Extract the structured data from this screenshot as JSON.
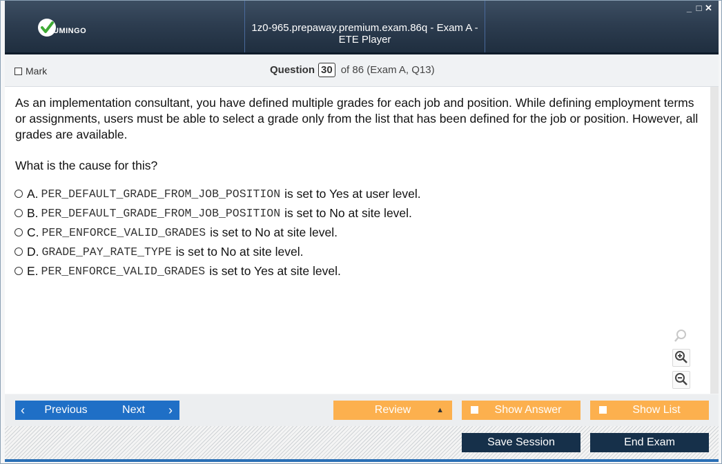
{
  "window": {
    "logo_text": "UMINGO",
    "title": "1z0-965.prepaway.premium.exam.86q - Exam A - ETE Player",
    "controls": [
      "_",
      "□",
      "✕"
    ]
  },
  "question_header": {
    "mark_label": "Mark",
    "question_label": "Question",
    "question_number": "30",
    "of_text": "of 86 (Exam A, Q13)"
  },
  "question": {
    "stem": "As an implementation consultant, you have defined multiple grades for each job and position. While defining employment terms or assignments, users must be able to select a grade only from the list that has been defined for the job or position. However, all grades are available.",
    "prompt": "What is the cause for this?",
    "options": [
      {
        "letter": "A.",
        "code": "PER_DEFAULT_GRADE_FROM_JOB_POSITION",
        "text": "is set to Yes at user level."
      },
      {
        "letter": "B.",
        "code": "PER_DEFAULT_GRADE_FROM_JOB_POSITION",
        "text": "is set to No at site level."
      },
      {
        "letter": "C.",
        "code": "PER_ENFORCE_VALID_GRADES",
        "text": "is set to No at site level."
      },
      {
        "letter": "D.",
        "code": "GRADE_PAY_RATE_TYPE",
        "text": "is set to No at site level."
      },
      {
        "letter": "E.",
        "code": "PER_ENFORCE_VALID_GRADES",
        "text": "is set to Yes at site level."
      }
    ]
  },
  "zoom": {
    "icons": [
      "search-icon",
      "zoom-in-icon",
      "zoom-out-icon"
    ]
  },
  "navigation": {
    "previous_label": "Previous",
    "next_label": "Next",
    "review_label": "Review",
    "show_answer_label": "Show Answer",
    "show_list_label": "Show List"
  },
  "footer": {
    "save_session_label": "Save Session",
    "end_exam_label": "End Exam"
  },
  "colors": {
    "titlebar": "#2d3d50",
    "nav_blue": "#1f6fc6",
    "orange": "#fcb04e",
    "dark_button": "#16304a"
  }
}
